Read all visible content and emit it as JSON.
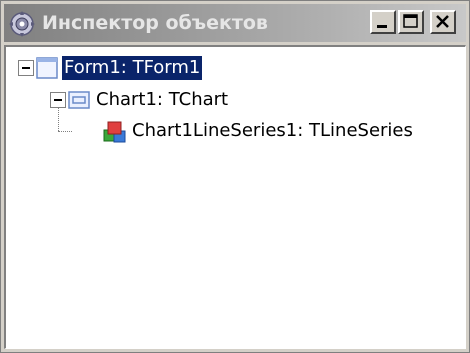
{
  "window": {
    "title": "Инспектор объектов",
    "icon": "object-inspector-icon",
    "buttons": {
      "minimize": "minimize-icon",
      "maximize": "maximize-icon",
      "close": "close-icon"
    }
  },
  "tree": {
    "nodes": [
      {
        "label": "Form1: TForm1",
        "icon": "form-icon",
        "expanded": true,
        "selected": true
      },
      {
        "label": "Chart1: TChart",
        "icon": "chart-icon",
        "expanded": true,
        "selected": false
      },
      {
        "label": "Chart1LineSeries1: TLineSeries",
        "icon": "line-series-icon",
        "expanded": false,
        "selected": false
      }
    ]
  },
  "colors": {
    "selection": "#0a246a",
    "titlebar": "#808080"
  }
}
